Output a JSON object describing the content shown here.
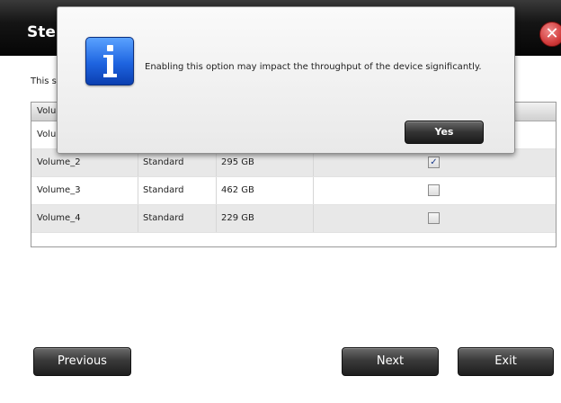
{
  "window": {
    "title": "Ste",
    "description": "This s"
  },
  "table": {
    "header": {
      "col1": "Volu"
    },
    "rows": [
      {
        "name": "Volu",
        "type": "",
        "size": "",
        "checked": null
      },
      {
        "name": "Volume_2",
        "type": "Standard",
        "size": "295 GB",
        "checked": true
      },
      {
        "name": "Volume_3",
        "type": "Standard",
        "size": "462 GB",
        "checked": false
      },
      {
        "name": "Volume_4",
        "type": "Standard",
        "size": "229 GB",
        "checked": false
      }
    ]
  },
  "buttons": {
    "previous": "Previous",
    "next": "Next",
    "exit": "Exit"
  },
  "dialog": {
    "message": "Enabling this option may impact the throughput of the device significantly.",
    "yes_label": "Yes",
    "icon": "info-icon"
  },
  "colors": {
    "title_bar": "#0a0a0a",
    "button_dark": "#2e2e2e",
    "info_blue": "#1e64e0",
    "close_red": "#d23c3c"
  }
}
